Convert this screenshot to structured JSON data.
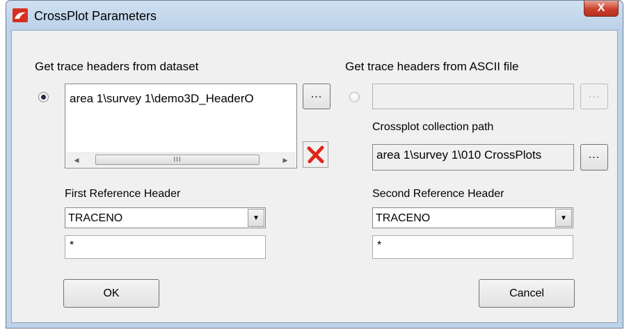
{
  "window": {
    "title": "CrossPlot Parameters",
    "close_glyph": "X"
  },
  "left": {
    "section_label": "Get trace headers from dataset",
    "dataset_items": [
      "area 1\\survey 1\\demo3D_HeaderO"
    ],
    "browse_label": "...",
    "scroll_thumb_grip": "III",
    "first_ref_label": "First Reference Header",
    "first_ref_value": "TRACENO",
    "first_ref_filter": "*"
  },
  "right": {
    "section_label": "Get trace headers from ASCII file",
    "ascii_path": "",
    "browse_label": "...",
    "collection_label": "Crossplot collection path",
    "collection_path": "area 1\\survey 1\\010 CrossPlots",
    "collection_browse_label": "...",
    "second_ref_label": "Second Reference Header",
    "second_ref_value": "TRACENO",
    "second_ref_filter": "*"
  },
  "buttons": {
    "ok": "OK",
    "cancel": "Cancel"
  },
  "colors": {
    "frame": "#bcd3ea",
    "client": "#f0f0f0",
    "close": "#c9412d",
    "delete_icon": "#e02418"
  }
}
